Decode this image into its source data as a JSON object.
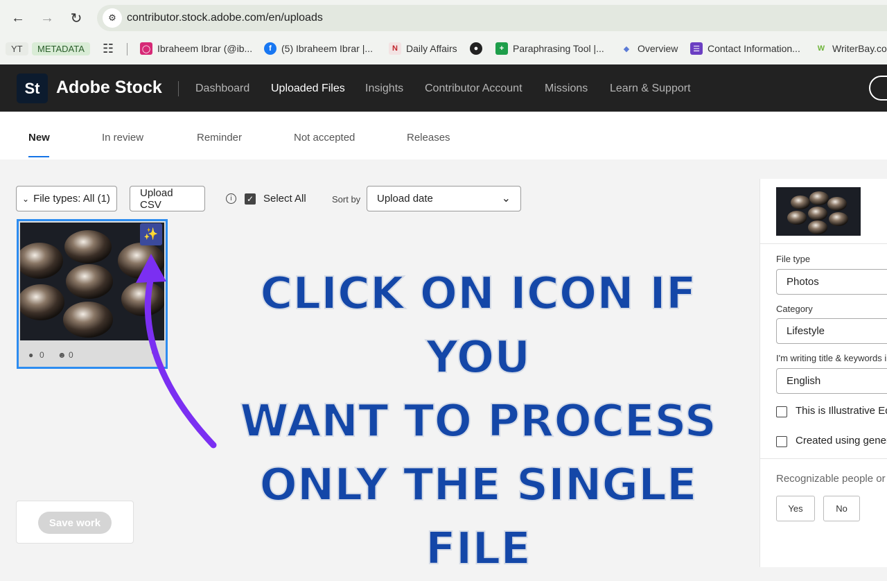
{
  "browser": {
    "url": "contributor.stock.adobe.com/en/uploads",
    "bookmarks": [
      {
        "label": "YT",
        "icon": "text-tag"
      },
      {
        "label": "METADATA",
        "icon": "text-tag"
      },
      {
        "label": "",
        "icon": "apps-grid-icon"
      },
      {
        "label": "Ibraheem Ibrar (@ib...",
        "icon": "instagram-icon"
      },
      {
        "label": "(5) Ibraheem Ibrar |...",
        "icon": "facebook-icon"
      },
      {
        "label": "Daily Affairs",
        "icon": "n-icon"
      },
      {
        "label": "",
        "icon": "globe-icon"
      },
      {
        "label": "Paraphrasing Tool |...",
        "icon": "sheet-icon"
      },
      {
        "label": "Overview",
        "icon": "overview-icon"
      },
      {
        "label": "Contact Information...",
        "icon": "form-icon"
      },
      {
        "label": "WriterBay.co",
        "icon": "w-icon"
      }
    ]
  },
  "header": {
    "logo_mark": "St",
    "logo_text": "Adobe Stock",
    "nav": [
      "Dashboard",
      "Uploaded Files",
      "Insights",
      "Contributor Account",
      "Missions",
      "Learn & Support"
    ],
    "active_nav": "Uploaded Files"
  },
  "tabs": {
    "items": [
      "New",
      "In review",
      "Reminder",
      "Not accepted",
      "Releases"
    ],
    "active": "New"
  },
  "toolbar": {
    "file_types": "File types: All (1)",
    "upload_csv": "Upload CSV",
    "select_all": "Select All",
    "sort_by_label": "Sort by",
    "sort_value": "Upload date"
  },
  "thumbnail": {
    "keywords_count": "0",
    "people_count": "0"
  },
  "annotation": {
    "lines": [
      "CLICK ON ICON IF YOU",
      "WANT TO PROCESS",
      "ONLY THE SINGLE FILE"
    ],
    "color": "#1447a8",
    "arrow_color": "#7b2ff2"
  },
  "save": {
    "label": "Save work"
  },
  "right_panel": {
    "file_type_label": "File type",
    "file_type_value": "Photos",
    "category_label": "Category",
    "category_value": "Lifestyle",
    "language_label": "I'm writing title & keywords i",
    "language_value": "English",
    "illustrative_label": "This is Illustrative Ed",
    "generative_label": "Created using genera",
    "people_question": "Recognizable people or p",
    "yes": "Yes",
    "no": "No"
  }
}
